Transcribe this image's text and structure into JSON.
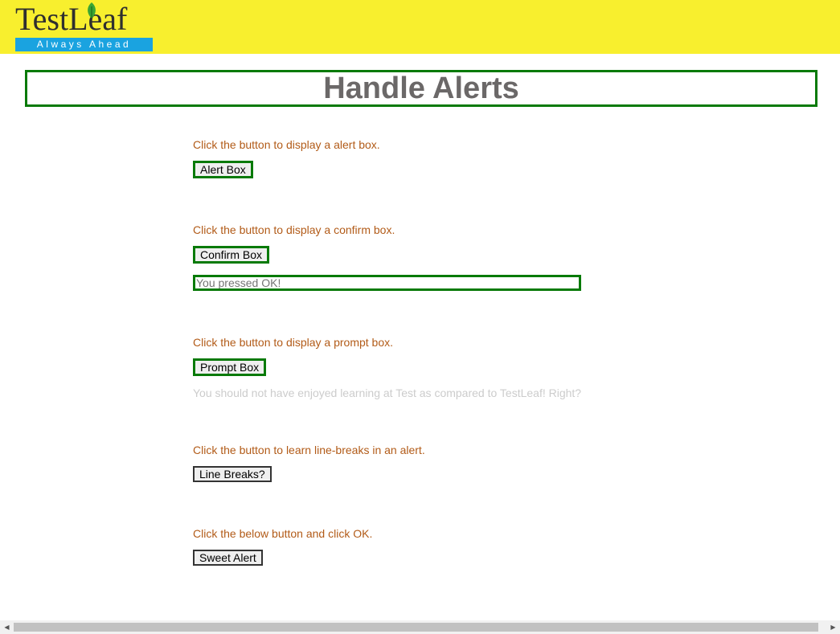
{
  "logo": {
    "brand": "TestLeaf",
    "tagline": "Always Ahead"
  },
  "page_title": "Handle Alerts",
  "sections": {
    "alert": {
      "label": "Click the button to display a alert box.",
      "button": "Alert Box"
    },
    "confirm": {
      "label": "Click the button to display a confirm box.",
      "button": "Confirm Box",
      "result_placeholder": "You pressed OK!"
    },
    "prompt": {
      "label": "Click the button to display a prompt box.",
      "button": "Prompt Box",
      "result_text": "You should not have enjoyed learning at Test as compared to TestLeaf! Right?"
    },
    "line_breaks": {
      "label": "Click the button to learn line-breaks in an alert.",
      "button": "Line Breaks?"
    },
    "sweet": {
      "label": "Click the below button and click OK.",
      "button": "Sweet Alert"
    }
  },
  "colors": {
    "header_bg": "#f8ef2e",
    "highlight_border": "#087a08",
    "label_text": "#b25b18",
    "title_text": "#6b6868",
    "tagline_bg": "#1aa3e0"
  },
  "icons": {
    "logo_leaf": "leaf-icon",
    "scroll_left": "scroll-left-arrow-icon",
    "scroll_right": "scroll-right-arrow-icon"
  }
}
